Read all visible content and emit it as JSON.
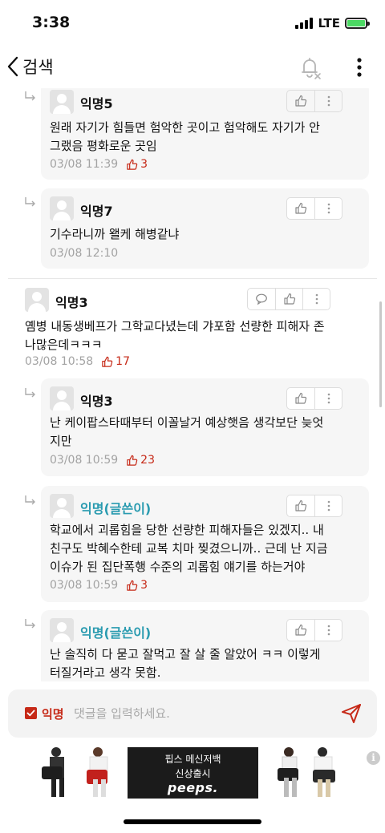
{
  "status_bar": {
    "time": "3:38",
    "network": "LTE"
  },
  "nav": {
    "back_label": "검색"
  },
  "comments": [
    {
      "nickname": "익명5",
      "text": "원래 자기가 힘들면 험악한 곳이고 험악해도 자기가 안\n그랬음 평화로운 곳임",
      "time": "03/08 11:39",
      "votes": "3"
    },
    {
      "nickname": "익명7",
      "text": "기수라니까 왤케 해병같냐",
      "time": "03/08 12:10",
      "votes": ""
    },
    {
      "nickname": "익명3",
      "text": "옘병 내동생베프가 그학교다녔는데 갸포함 선량한 피해자 존\n나많은데ㅋㅋㅋ",
      "time": "03/08 10:58",
      "votes": "17"
    },
    {
      "nickname": "익명3",
      "text": "난 케이팝스타때부터 이꼴날거 예상햇음 생각보단 늦엇\n지만",
      "time": "03/08 10:59",
      "votes": "23"
    },
    {
      "nickname": "익명(글쓴이)",
      "text": "학교에서 괴롭힘을 당한 선량한 피해자들은 있겠지.. 내\n친구도 박혜수한테 교복 치마 찢겼으니까.. 근데 난 지금\n이슈가 된 집단폭행 수준의 괴롭힘 얘기를 하는거야",
      "time": "03/08 10:59",
      "votes": "3"
    },
    {
      "nickname": "익명(글쓴이)",
      "text": "난 솔직히 다 묻고 잘먹고 잘 살 줄 알았어 ㅋㅋ 이렇게\n터질거라고 생각 못함.",
      "time": "",
      "votes": ""
    }
  ],
  "input": {
    "anonymous_label": "익명",
    "placeholder": "댓글을 입력하세요."
  },
  "ad": {
    "line1": "핍스 메신저백",
    "line2": "신상출시",
    "brand": "peeps."
  },
  "colors": {
    "accent_red": "#c62917",
    "writer_teal": "#2a9bb0"
  }
}
